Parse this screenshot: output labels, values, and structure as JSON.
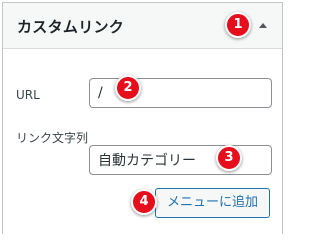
{
  "panel": {
    "title": "カスタムリンク",
    "toggle_icon": "triangle-up-icon"
  },
  "url_field": {
    "label": "URL",
    "value": "/"
  },
  "link_text_field": {
    "label": "リンク文字列",
    "value": "自動カテゴリー"
  },
  "add_button": {
    "label": "メニューに追加"
  },
  "markers": [
    "1",
    "2",
    "3",
    "4"
  ],
  "colors": {
    "marker": "#e60e1c",
    "button_accent": "#2271b1",
    "header_bg": "#f6f7f7"
  }
}
